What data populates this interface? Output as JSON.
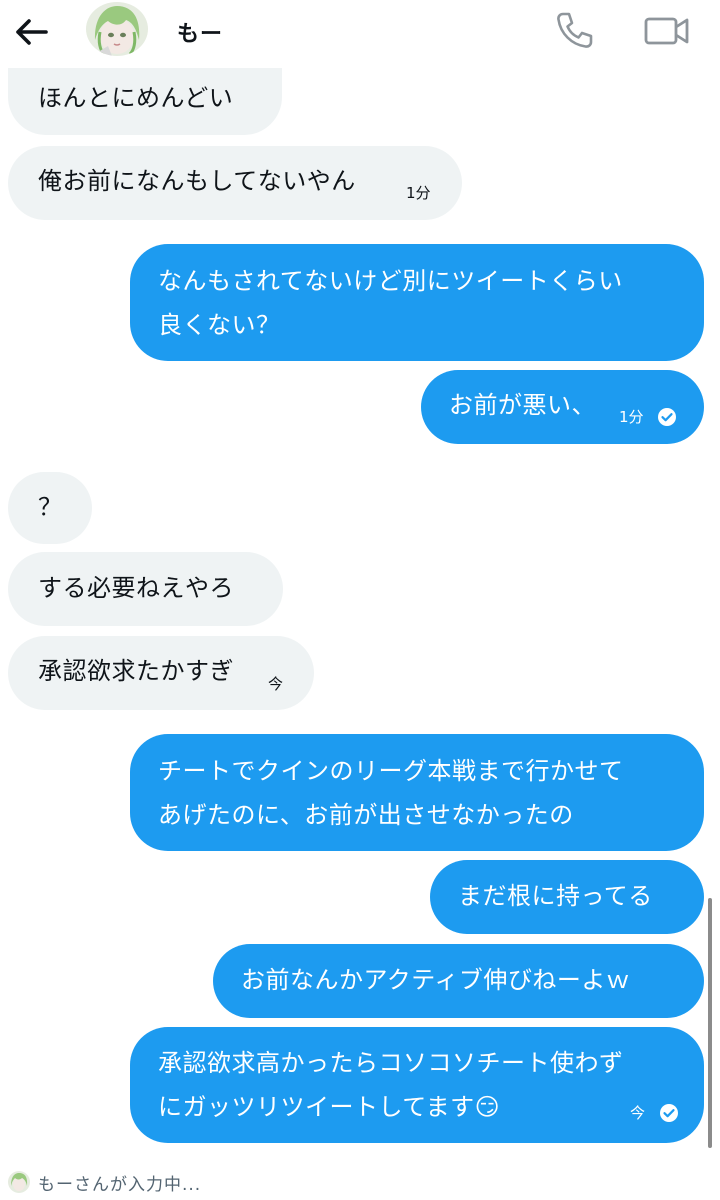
{
  "header": {
    "back_icon": "arrow-left-icon",
    "name": "もー",
    "call_icon": "phone-icon",
    "video_icon": "video-camera-icon"
  },
  "messages": [
    {
      "side": "received",
      "text": "ほんとにめんどい"
    },
    {
      "side": "received",
      "text": "俺お前になんもしてないやん",
      "time": "1分"
    },
    {
      "side": "sent",
      "lines": [
        "なんもされてないけど別にツイートくらい",
        "良くない？"
      ]
    },
    {
      "side": "sent",
      "text": "お前が悪い、",
      "time": "1分",
      "read_icon": "check-circle-icon"
    },
    {
      "side": "received",
      "text": "？"
    },
    {
      "side": "received",
      "text": "する必要ねえやろ"
    },
    {
      "side": "received",
      "text": "承認欲求たかすぎ",
      "time": "今"
    },
    {
      "side": "sent",
      "lines": [
        "チートでクインのリーグ本戦まで行かせて",
        "あげたのに、お前が出させなかったの"
      ]
    },
    {
      "side": "sent",
      "text": "まだ根に持ってる"
    },
    {
      "side": "sent",
      "text": "お前なんかアクティブ伸びねーよｗ"
    },
    {
      "side": "sent",
      "lines": [
        "承認欲求高かったらコソコソチート使わず",
        "にガッツリツイートしてます😏"
      ],
      "time": "今",
      "read_icon": "check-circle-icon"
    }
  ],
  "typing": {
    "text": "もーさんが入力中..."
  },
  "colors": {
    "sent_bubble": "#1d9bf0",
    "received_bubble": "#eff3f4"
  }
}
